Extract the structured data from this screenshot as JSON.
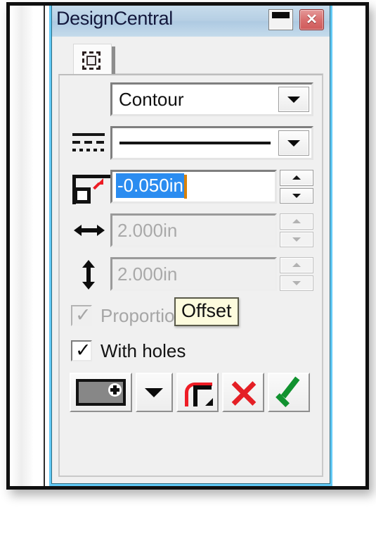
{
  "window": {
    "title": "DesignCentral",
    "minimize_label": "—",
    "close_label": "✕",
    "titlebar_color": "#b6cfe4",
    "border_color": "#62c9f5"
  },
  "tabs": [
    {
      "name": "contour-tab",
      "icon": "dashed-square-icon",
      "selected": true
    }
  ],
  "fields": {
    "mode": {
      "label": "Contour",
      "options": [
        "Contour"
      ]
    },
    "line_style": {
      "icon": "line-style-icon",
      "value": "solid-line"
    },
    "offset": {
      "icon": "offset-icon",
      "value": "-0.050in",
      "selected": true,
      "enabled": true
    },
    "width": {
      "icon": "horizontal-arrow-icon",
      "value": "2.000in",
      "enabled": false
    },
    "height": {
      "icon": "vertical-arrow-icon",
      "value": "2.000in",
      "enabled": false
    }
  },
  "checkboxes": [
    {
      "name": "proportional",
      "label": "Proportional",
      "checked": true,
      "enabled": false
    },
    {
      "name": "with-holes",
      "label": "With holes",
      "checked": true,
      "enabled": true
    }
  ],
  "toolbar": {
    "fill_swatch": {
      "name": "fill-color-swatch",
      "color": "#878787"
    },
    "fill_dropdown": {
      "name": "fill-dropdown-button"
    },
    "corner_style": {
      "name": "corner-style-button"
    },
    "cancel": {
      "name": "cancel-button",
      "color": "#e41f25"
    },
    "apply": {
      "name": "apply-button",
      "color": "#11922f"
    }
  },
  "tooltip": {
    "text": "Offset",
    "background": "#fdfbdd"
  }
}
